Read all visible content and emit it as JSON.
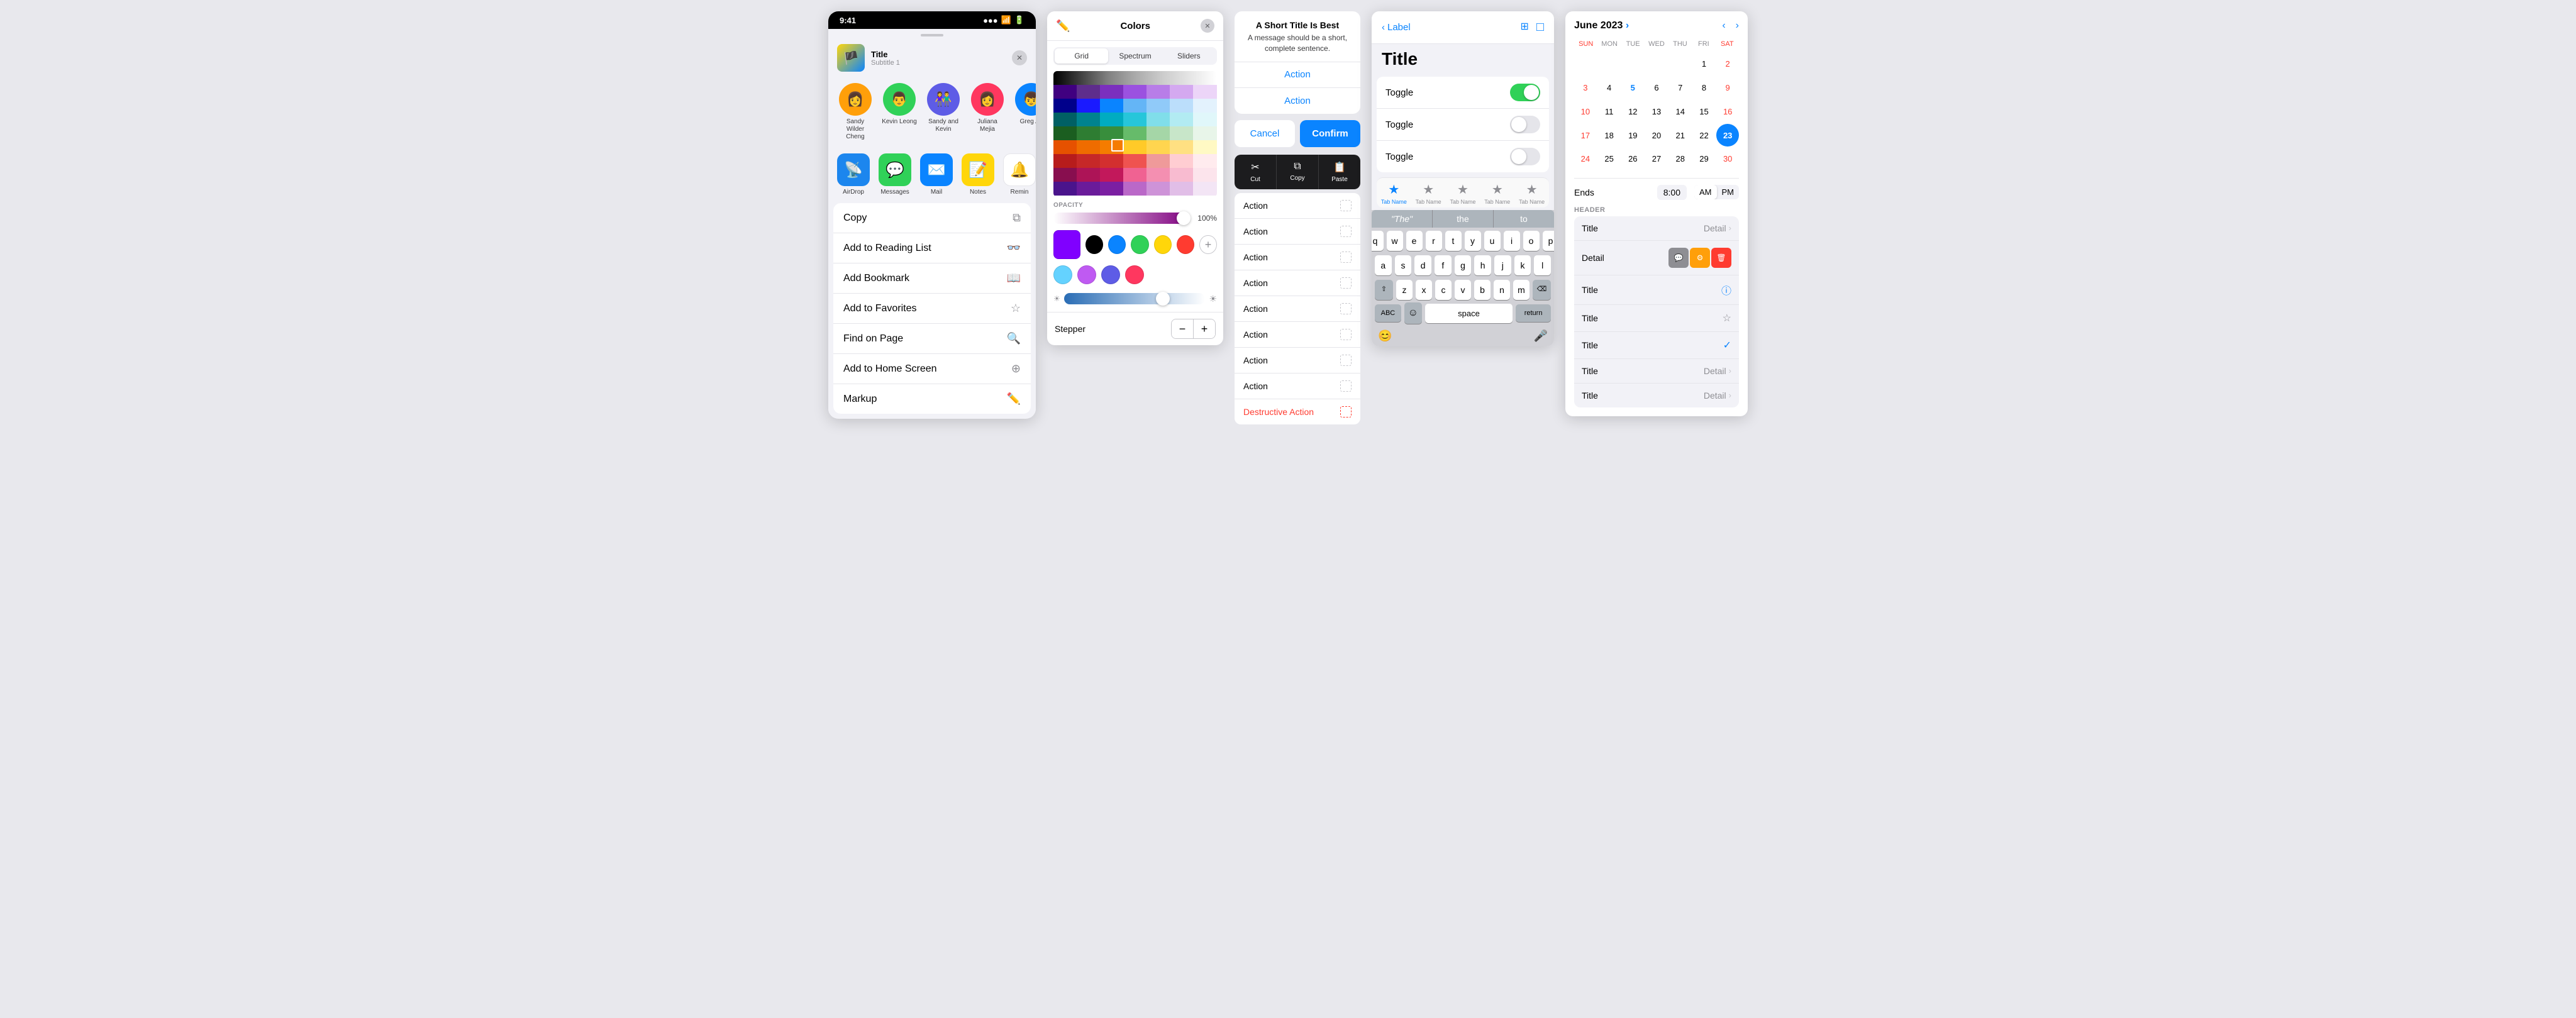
{
  "statusBar": {
    "time": "9:41",
    "signal": "●●●",
    "wifi": "WiFi",
    "battery": "Battery"
  },
  "shareSheet": {
    "title": "Title",
    "subtitle": "Subtitle 1",
    "contacts": [
      {
        "name": "Sandy Wilder Cheng",
        "emoji": "👩"
      },
      {
        "name": "Kevin Leong",
        "emoji": "👨"
      },
      {
        "name": "Sandy and Kevin",
        "emoji": "👫"
      },
      {
        "name": "Juliana Mejia",
        "emoji": "👩"
      },
      {
        "name": "Greg Ap",
        "emoji": "👦"
      }
    ],
    "apps": [
      {
        "name": "AirDrop",
        "emoji": "📡"
      },
      {
        "name": "Messages",
        "emoji": "💬"
      },
      {
        "name": "Mail",
        "emoji": "✉️"
      },
      {
        "name": "Notes",
        "emoji": "📝"
      },
      {
        "name": "Remin",
        "emoji": "🔔"
      }
    ],
    "actions": [
      {
        "label": "Copy",
        "icon": "⧉"
      },
      {
        "label": "Add to Reading List",
        "icon": "👓"
      },
      {
        "label": "Add Bookmark",
        "icon": "📖"
      },
      {
        "label": "Add to Favorites",
        "icon": "☆"
      },
      {
        "label": "Find on Page",
        "icon": "🔍"
      },
      {
        "label": "Add to Home Screen",
        "icon": "⊕"
      },
      {
        "label": "Markup",
        "icon": "✏️"
      }
    ]
  },
  "colorPicker": {
    "title": "Colors",
    "tabs": [
      "Grid",
      "Spectrum",
      "Sliders"
    ],
    "activeTab": "Grid",
    "opacityLabel": "OPACITY",
    "opacityValue": "100%",
    "stepperLabel": "Stepper",
    "swatches": [
      {
        "color": "#000000"
      },
      {
        "color": "#0a84ff"
      },
      {
        "color": "#30d158"
      },
      {
        "color": "#ffd60a"
      },
      {
        "color": "#ff3b30"
      }
    ],
    "swatchRow2": [
      {
        "color": "#64d2ff"
      },
      {
        "color": "#bf5af2"
      },
      {
        "color": "#5e5ce6"
      },
      {
        "color": "#ff375f"
      }
    ]
  },
  "actionSheet": {
    "alertTitle": "A Short Title Is Best",
    "alertMessage": "A message should be a short, complete sentence.",
    "actions": [
      {
        "label": "Action",
        "style": "normal"
      },
      {
        "label": "Action",
        "style": "normal"
      }
    ],
    "cancelLabel": "Cancel",
    "confirmLabel": "Confirm",
    "contextIcons": [
      {
        "label": "Cut",
        "symbol": "✂"
      },
      {
        "label": "Copy",
        "symbol": "⧉"
      },
      {
        "label": "Paste",
        "symbol": "📋"
      }
    ],
    "menuItems": [
      {
        "label": "Action",
        "style": "normal"
      },
      {
        "label": "Action",
        "style": "normal"
      },
      {
        "label": "Action",
        "style": "normal"
      },
      {
        "label": "Action",
        "style": "normal"
      },
      {
        "label": "Action",
        "style": "normal"
      },
      {
        "label": "Action",
        "style": "normal"
      },
      {
        "label": "Action",
        "style": "normal"
      },
      {
        "label": "Action",
        "style": "normal"
      },
      {
        "label": "Destructive Action",
        "style": "destructive"
      }
    ]
  },
  "settingsPanel": {
    "backLabel": "Label",
    "title": "Title",
    "toggles": [
      {
        "label": "Toggle",
        "on": true
      },
      {
        "label": "Toggle",
        "on": false
      },
      {
        "label": "Toggle",
        "on": false
      }
    ],
    "tabs": [
      {
        "label": "Tab Name",
        "active": true
      },
      {
        "label": "Tab Name",
        "active": false
      },
      {
        "label": "Tab Name",
        "active": false
      },
      {
        "label": "Tab Name",
        "active": false
      },
      {
        "label": "Tab Name",
        "active": false
      }
    ],
    "keyboard": {
      "predictive": [
        "\"The\"",
        "the",
        "to"
      ],
      "rows": [
        [
          "q",
          "w",
          "e",
          "r",
          "t",
          "y",
          "u",
          "i",
          "o",
          "p"
        ],
        [
          "a",
          "s",
          "d",
          "f",
          "g",
          "h",
          "j",
          "k",
          "l"
        ],
        [
          "z",
          "x",
          "c",
          "v",
          "b",
          "n",
          "m"
        ]
      ]
    }
  },
  "calendar": {
    "month": "June 2023",
    "chevron": "›",
    "dayHeaders": [
      "SUN",
      "MON",
      "TUE",
      "WED",
      "THU",
      "FRI",
      "SAT"
    ],
    "days": [
      {
        "day": "",
        "empty": true
      },
      {
        "day": "",
        "empty": true
      },
      {
        "day": "",
        "empty": true
      },
      {
        "day": "",
        "empty": true
      },
      {
        "day": "",
        "empty": true
      },
      {
        "day": "1"
      },
      {
        "day": "2"
      },
      {
        "day": "3"
      },
      {
        "day": "4"
      },
      {
        "day": "5",
        "blue": true
      },
      {
        "day": "6"
      },
      {
        "day": "7"
      },
      {
        "day": "8"
      },
      {
        "day": "9"
      },
      {
        "day": "10"
      },
      {
        "day": "11"
      },
      {
        "day": "12"
      },
      {
        "day": "13"
      },
      {
        "day": "14"
      },
      {
        "day": "15"
      },
      {
        "day": "16"
      },
      {
        "day": "17"
      },
      {
        "day": "18"
      },
      {
        "day": "19"
      },
      {
        "day": "20"
      },
      {
        "day": "21"
      },
      {
        "day": "22"
      },
      {
        "day": "23",
        "today": true
      },
      {
        "day": "24"
      },
      {
        "day": "25"
      },
      {
        "day": "26"
      },
      {
        "day": "27"
      },
      {
        "day": "28"
      },
      {
        "day": "29"
      },
      {
        "day": "30"
      }
    ],
    "timeSection": {
      "label": "Ends",
      "time": "8:00",
      "am": "AM",
      "pm": "PM"
    },
    "headerLabel": "HEADER",
    "detailRows": [
      {
        "label": "Title",
        "value": "Detail",
        "icon": "chevron",
        "special": null
      },
      {
        "label": "Detail",
        "value": "",
        "icon": "actions",
        "special": null
      },
      {
        "label": "Title",
        "value": "",
        "icon": "info",
        "special": null
      },
      {
        "label": "Title",
        "value": "",
        "icon": "star",
        "special": null
      },
      {
        "label": "Title",
        "value": "",
        "icon": "check",
        "special": null
      },
      {
        "label": "Title",
        "value": "Detail",
        "icon": "chevron",
        "special": null
      },
      {
        "label": "Title",
        "value": "Detail",
        "icon": "chevron",
        "special": null
      }
    ]
  }
}
